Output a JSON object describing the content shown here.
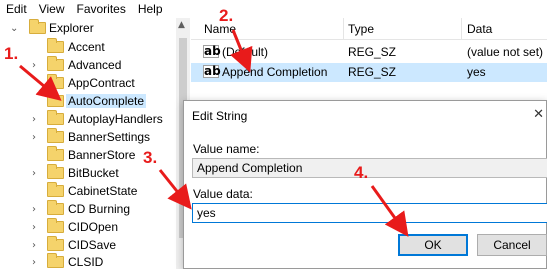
{
  "menu": [
    "Edit",
    "View",
    "Favorites",
    "Help"
  ],
  "tree": {
    "parent": "Explorer",
    "items": [
      {
        "label": "Accent",
        "selected": false
      },
      {
        "label": "Advanced",
        "selected": false
      },
      {
        "label": "AppContract",
        "selected": false
      },
      {
        "label": "AutoComplete",
        "selected": true
      },
      {
        "label": "AutoplayHandlers",
        "selected": false
      },
      {
        "label": "BannerSettings",
        "selected": false
      },
      {
        "label": "BannerStore",
        "selected": false
      },
      {
        "label": "BitBucket",
        "selected": false
      },
      {
        "label": "CabinetState",
        "selected": false
      },
      {
        "label": "CD Burning",
        "selected": false
      },
      {
        "label": "CIDOpen",
        "selected": false
      },
      {
        "label": "CIDSave",
        "selected": false
      },
      {
        "label": "CLSID",
        "selected": false
      }
    ]
  },
  "values": {
    "columns": {
      "name": "Name",
      "type": "Type",
      "data": "Data"
    },
    "rows": [
      {
        "name": "(Default)",
        "type": "REG_SZ",
        "data": "(value not set)"
      },
      {
        "name": "Append Completion",
        "type": "REG_SZ",
        "data": "yes"
      }
    ]
  },
  "dialog": {
    "title": "Edit String",
    "close_glyph": "✕",
    "value_name_label": "Value name:",
    "value_name": "Append Completion",
    "value_data_label": "Value data:",
    "value_data": "yes",
    "ok_label": "OK",
    "cancel_label": "Cancel"
  },
  "annotations": [
    "1.",
    "2.",
    "3.",
    "4."
  ],
  "colors": {
    "annotation": "#e81b1b",
    "selection": "#cce8ff",
    "folder": "#f5d36b",
    "accent": "#0078d7"
  }
}
